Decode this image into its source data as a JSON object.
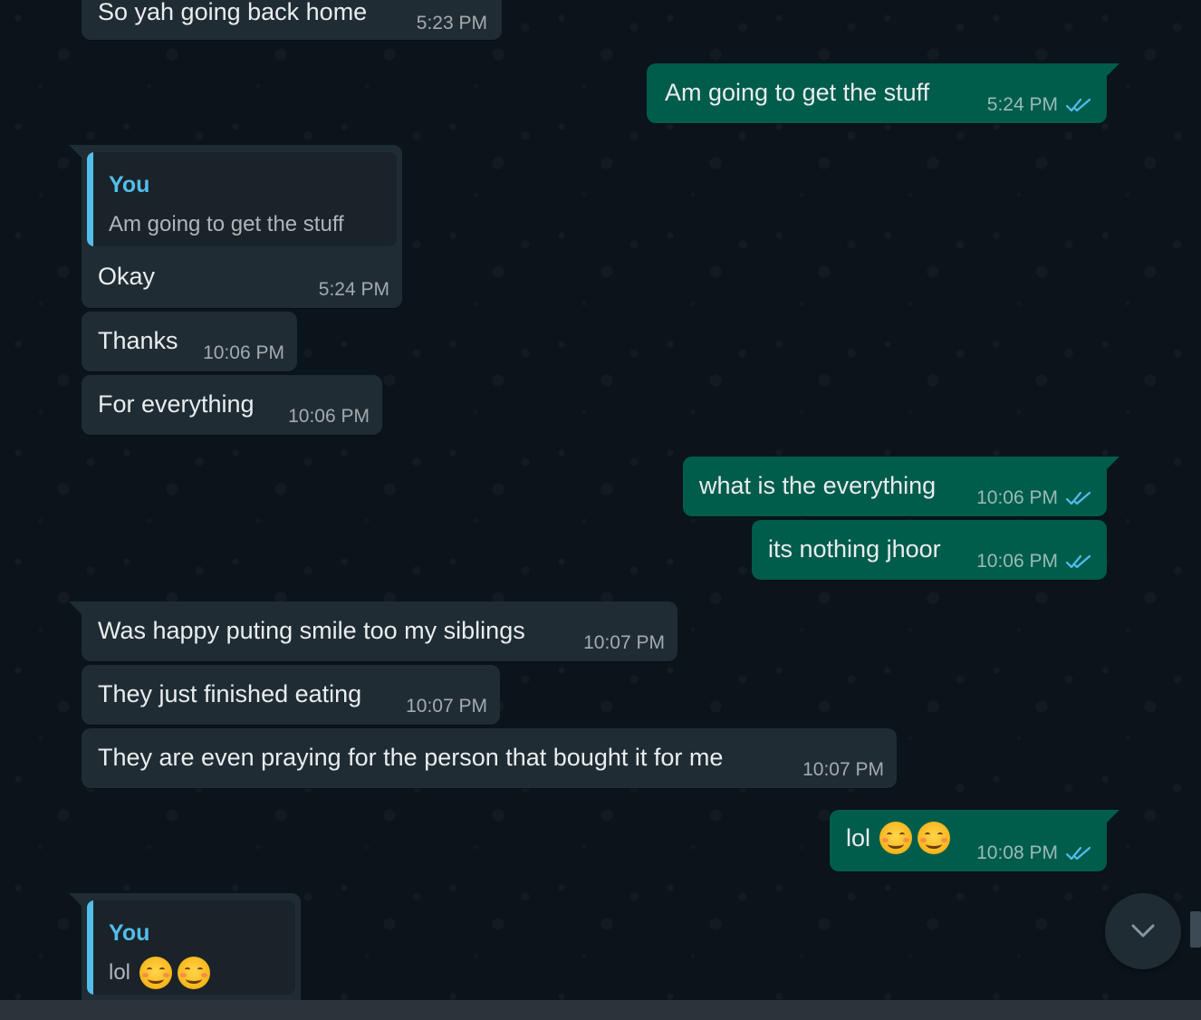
{
  "colors": {
    "background": "#0b141a",
    "incoming_bubble": "#202c33",
    "outgoing_bubble": "#005c4b",
    "quote_accent": "#53bdeb",
    "read_check": "#53bdeb"
  },
  "messages": [
    {
      "text": "So yah going back home",
      "time": "5:23 PM"
    },
    {
      "text": "Am going to get the stuff",
      "time": "5:24 PM",
      "status": "read"
    },
    {
      "quote_name": "You",
      "quote_text": "Am going to get the stuff",
      "text": "Okay",
      "time": "5:24 PM"
    },
    {
      "text": "Thanks",
      "time": "10:06 PM"
    },
    {
      "text": "For everything",
      "time": "10:06 PM"
    },
    {
      "text": "what is the everything",
      "time": "10:06 PM",
      "status": "read"
    },
    {
      "text": "its nothing jhoor",
      "time": "10:06 PM",
      "status": "read"
    },
    {
      "text": "Was happy puting smile too my siblings",
      "time": "10:07 PM"
    },
    {
      "text": "They just finished eating",
      "time": "10:07 PM"
    },
    {
      "text": "They are even praying for the person that bought it for me",
      "time": "10:07 PM"
    },
    {
      "text": "lol",
      "emoji": "smiling-face-emoji",
      "time": "10:08 PM",
      "status": "read"
    },
    {
      "quote_name": "You",
      "quote_text": "lol",
      "emoji": "smiling-face-emoji"
    }
  ],
  "icons": {
    "read_receipt": "double-check-icon",
    "scroll_down": "chevron-down-icon"
  }
}
